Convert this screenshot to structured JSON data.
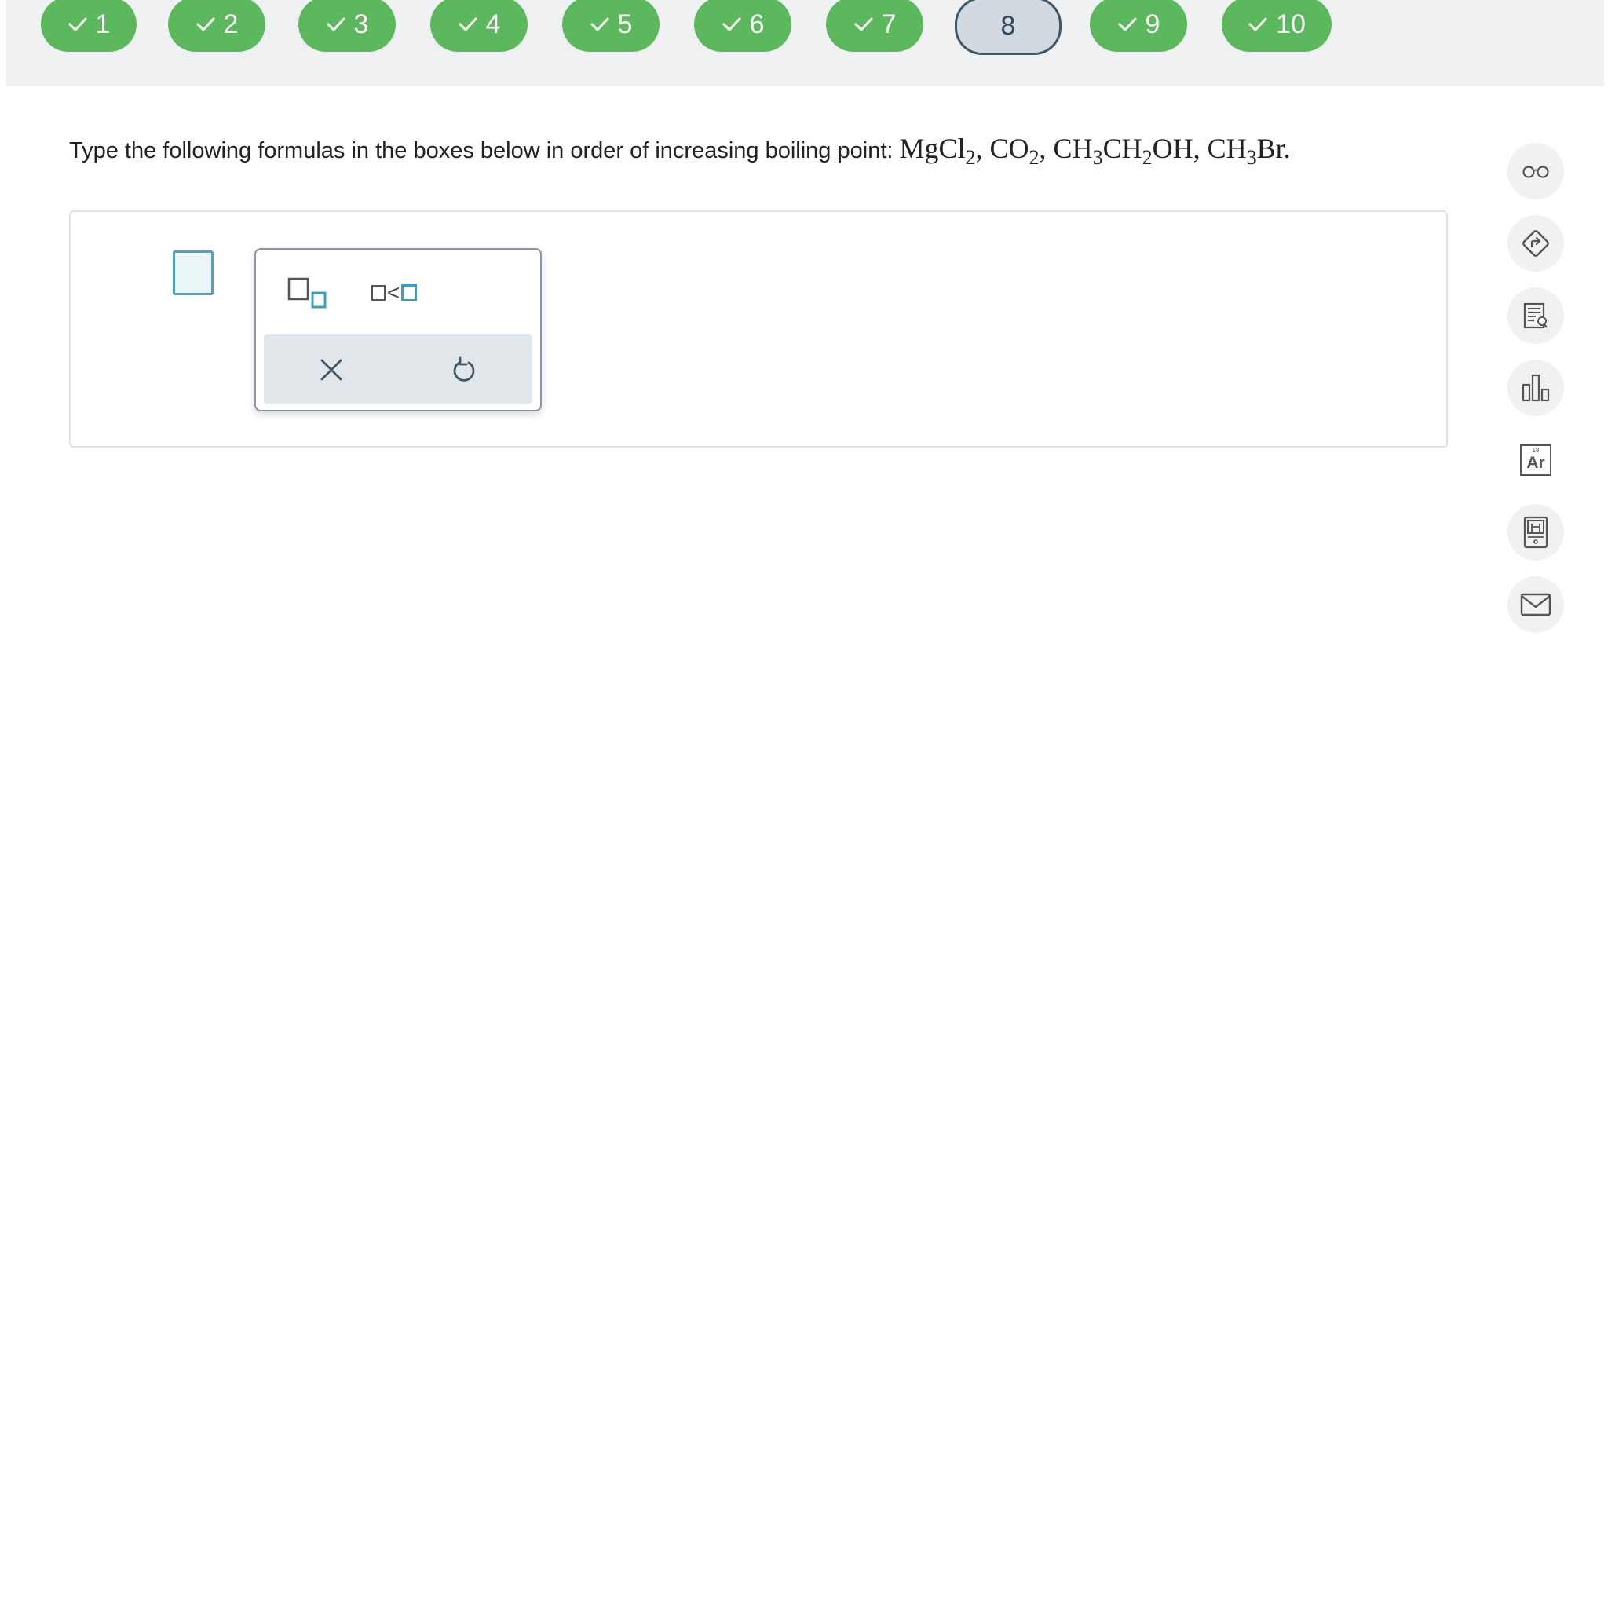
{
  "nav": {
    "questions": [
      {
        "label": "1",
        "done": true
      },
      {
        "label": "2",
        "done": true
      },
      {
        "label": "3",
        "done": true
      },
      {
        "label": "4",
        "done": true
      },
      {
        "label": "5",
        "done": true
      },
      {
        "label": "6",
        "done": true
      },
      {
        "label": "7",
        "done": true
      },
      {
        "label": "8",
        "done": false,
        "current": true
      },
      {
        "label": "9",
        "done": true
      },
      {
        "label": "10",
        "done": true
      }
    ]
  },
  "question": {
    "prompt": "Type the following formulas in the boxes below in order of increasing boiling point:",
    "formulas": {
      "mgcl2": [
        "MgCl",
        "2"
      ],
      "co2": [
        "CO",
        "2"
      ],
      "ethanol": [
        "CH",
        "3",
        "CH",
        "2",
        "OH"
      ],
      "ch3br": [
        "CH",
        "3",
        "Br"
      ]
    }
  },
  "palette": {
    "less_than_symbol": "<",
    "tools": [
      "subscript-tool",
      "less-than-tool"
    ],
    "actions": [
      "clear",
      "undo"
    ]
  },
  "sidebar": {
    "tools": [
      "glasses-icon",
      "directions-icon",
      "notes-icon",
      "bar-chart-icon",
      "periodic-table-icon",
      "calculator-icon",
      "mail-icon"
    ],
    "periodic_table": {
      "number": "18",
      "symbol": "Ar"
    }
  },
  "colors": {
    "done_pill": "#5cb85c",
    "current_pill": "#d3d9e1",
    "accent": "#4aa3c0",
    "topbar": "#f0f1f3"
  }
}
